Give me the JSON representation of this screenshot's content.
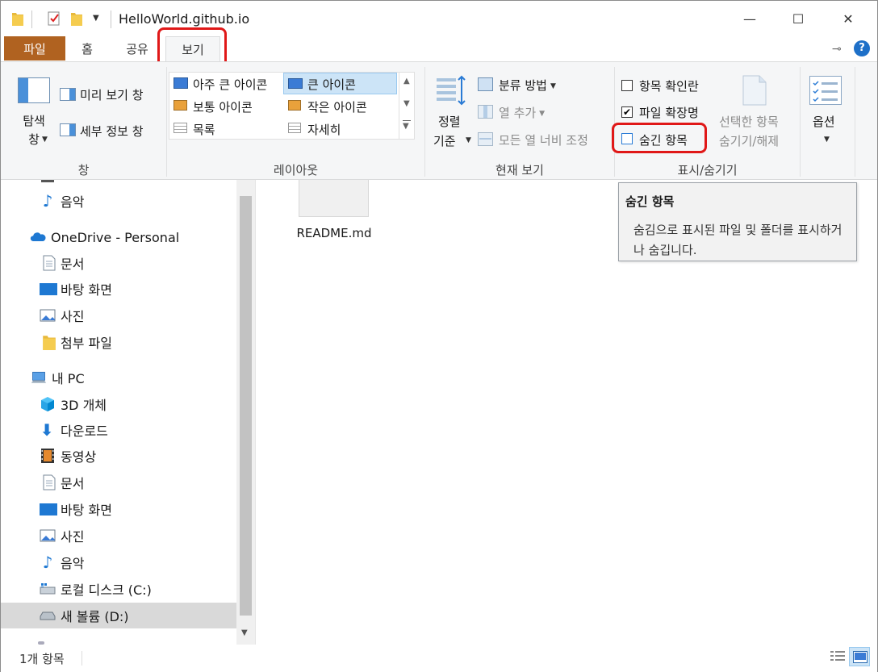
{
  "window": {
    "title": "HelloWorld.github.io",
    "controls": {
      "minimize": "—",
      "maximize": "☐",
      "close": "✕"
    }
  },
  "tabs": [
    {
      "label": "파일"
    },
    {
      "label": "홈"
    },
    {
      "label": "공유"
    },
    {
      "label": "보기"
    }
  ],
  "ribbon": {
    "panes": {
      "navigation_pane": "탐색\n창",
      "preview_pane": "미리 보기 창",
      "details_pane": "세부 정보 창",
      "group_label": "창"
    },
    "layout": {
      "items": [
        "아주 큰 아이콘",
        "큰 아이콘",
        "보통 아이콘",
        "작은 아이콘",
        "목록",
        "자세히"
      ],
      "selected": "큰 아이콘",
      "group_label": "레이아웃"
    },
    "current_view": {
      "sort_by_line1": "정렬",
      "sort_by_line2": "기준",
      "group_by": "분류 방법",
      "add_columns": "열 추가",
      "size_all_columns": "모든 열 너비 조정",
      "group_label": "현재 보기"
    },
    "show_hide": {
      "item_checkboxes": "항목 확인란",
      "item_checkboxes_checked": false,
      "file_extensions": "파일 확장명",
      "file_extensions_checked": true,
      "hidden_items": "숨긴 항목",
      "hidden_items_checked": false,
      "hide_selected_line1": "선택한 항목",
      "hide_selected_line2": "숨기기/해제",
      "group_label": "표시/숨기기"
    },
    "options": {
      "label": "옵션"
    }
  },
  "tooltip": {
    "title": "숨긴 항목",
    "body": "숨김으로 표시된 파일 및 폴더를 표시하거나 숨깁니다."
  },
  "nav": {
    "items": [
      {
        "label": "음악",
        "icon": "music-icon"
      },
      {
        "label": "OneDrive - Personal",
        "icon": "onedrive-icon"
      },
      {
        "label": "문서",
        "icon": "document-icon"
      },
      {
        "label": "바탕 화면",
        "icon": "desktop-icon"
      },
      {
        "label": "사진",
        "icon": "pictures-icon"
      },
      {
        "label": "첨부 파일",
        "icon": "folder-icon"
      },
      {
        "label": "내 PC",
        "icon": "pc-icon"
      },
      {
        "label": "3D 개체",
        "icon": "3d-objects-icon"
      },
      {
        "label": "다운로드",
        "icon": "download-icon"
      },
      {
        "label": "동영상",
        "icon": "video-icon"
      },
      {
        "label": "문서",
        "icon": "document-icon"
      },
      {
        "label": "바탕 화면",
        "icon": "desktop-icon"
      },
      {
        "label": "사진",
        "icon": "pictures-icon"
      },
      {
        "label": "음악",
        "icon": "music-icon"
      },
      {
        "label": "로컬 디스크 (C:)",
        "icon": "local-disk-icon"
      },
      {
        "label": "새 볼륨 (D:)",
        "icon": "drive-icon",
        "selected": true
      }
    ]
  },
  "content": {
    "files": [
      {
        "name": "README.md"
      }
    ]
  },
  "status": {
    "item_count": "1개 항목"
  },
  "colors": {
    "file_tab": "#b06220",
    "highlight": "#e01818",
    "selection": "#cce4f7",
    "accent": "#0078d7"
  }
}
